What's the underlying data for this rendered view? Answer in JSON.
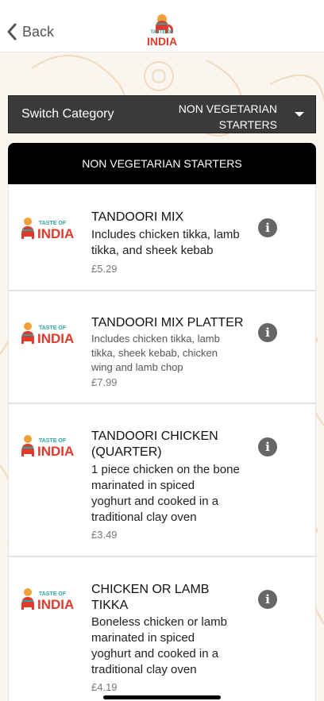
{
  "nav": {
    "back_label": "Back",
    "logo_text_top": "TASTE OF",
    "logo_text_bottom": "INDIA"
  },
  "switch_category": {
    "label": "Switch Category",
    "value_line1": "NON VEGETARIAN",
    "value_line2": "STARTERS"
  },
  "category_header": "NON VEGETARIAN STARTERS",
  "items": [
    {
      "title_line1": "TANDOORI MIX",
      "title_line2": "",
      "desc_lines": [
        "Includes chicken tikka, lamb",
        "tikka, and sheek kebab"
      ],
      "price": "£5.29"
    },
    {
      "title_line1": "TANDOORI MIX PLATTER",
      "title_line2": "",
      "desc_lines": [
        "Includes chicken tikka, lamb",
        "tikka, sheek kebab, chicken",
        "wing and lamb chop"
      ],
      "price": "£7.99"
    },
    {
      "title_line1": "TANDOORI CHICKEN",
      "title_line2": "(QUARTER)",
      "desc_lines": [
        "1 piece chicken on the bone",
        "marinated in spiced",
        "yoghurt and cooked in a",
        "traditional clay oven"
      ],
      "price": "£3.49"
    },
    {
      "title_line1": "CHICKEN OR LAMB",
      "title_line2": "TIKKA",
      "desc_lines": [
        "Boneless chicken or lamb",
        "marinated in spiced",
        "yoghurt and cooked in a",
        "traditional clay oven"
      ],
      "price": "£4.19"
    }
  ],
  "thumb_logo": {
    "top": "TASTE OF",
    "bottom": "INDIA"
  },
  "info_glyph": "i",
  "colors": {
    "brand_red": "#e03a2c",
    "brand_teal": "#2aa6a0",
    "brand_orange": "#f2a03a",
    "dark_bar": "#3a3a3a"
  }
}
